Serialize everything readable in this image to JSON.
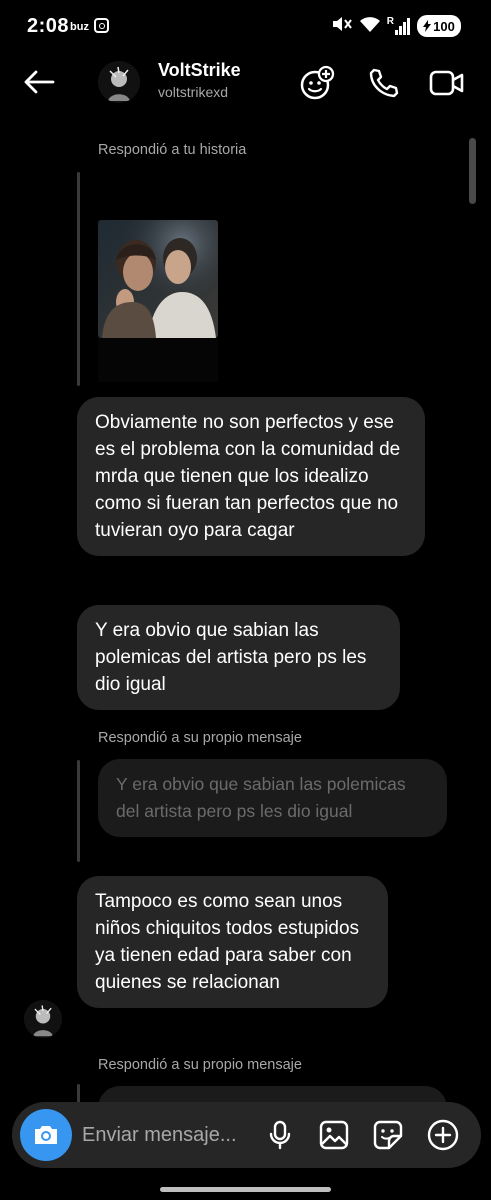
{
  "status_bar": {
    "time": "2:08",
    "carrier": "buz",
    "battery": "100",
    "network": "R"
  },
  "header": {
    "username": "VoltStrike",
    "handle": "voltstrikexd",
    "back_icon": "arrow-left-icon",
    "effects_icon": "face-plus-icon",
    "call_icon": "phone-icon",
    "video_icon": "video-camera-icon"
  },
  "messages": [
    {
      "type": "story_reply",
      "label": "Respondió a tu historia"
    },
    {
      "type": "text",
      "text": "Obviamente no son perfectos y ese es el problema con la comunidad de mrda que tienen que los idealizo como si fueran tan perfectos que no tuvieran oyo para cagar"
    },
    {
      "type": "text",
      "text": "Y era obvio que sabian las polemicas del artista pero ps les dio igual"
    },
    {
      "type": "self_reply",
      "label": "Respondió a su propio mensaje",
      "quoted": "Y era obvio que sabian las polemicas del artista pero ps les dio igual"
    },
    {
      "type": "text",
      "text": "Tampoco es como sean unos niños chiquitos todos estupidos ya tienen edad para saber con quienes se relacionan"
    },
    {
      "type": "self_reply",
      "label": "Respondió a su propio mensaje"
    }
  ],
  "composer": {
    "placeholder": "Enviar mensaje...",
    "icons": [
      "camera-icon",
      "microphone-icon",
      "image-icon",
      "sticker-icon",
      "plus-circle-icon"
    ]
  },
  "colors": {
    "background": "#000000",
    "bubble": "#262626",
    "quoted_bubble": "#1b1b1b",
    "secondary_text": "#a8a8a8",
    "camera_button": "#3797f0"
  }
}
